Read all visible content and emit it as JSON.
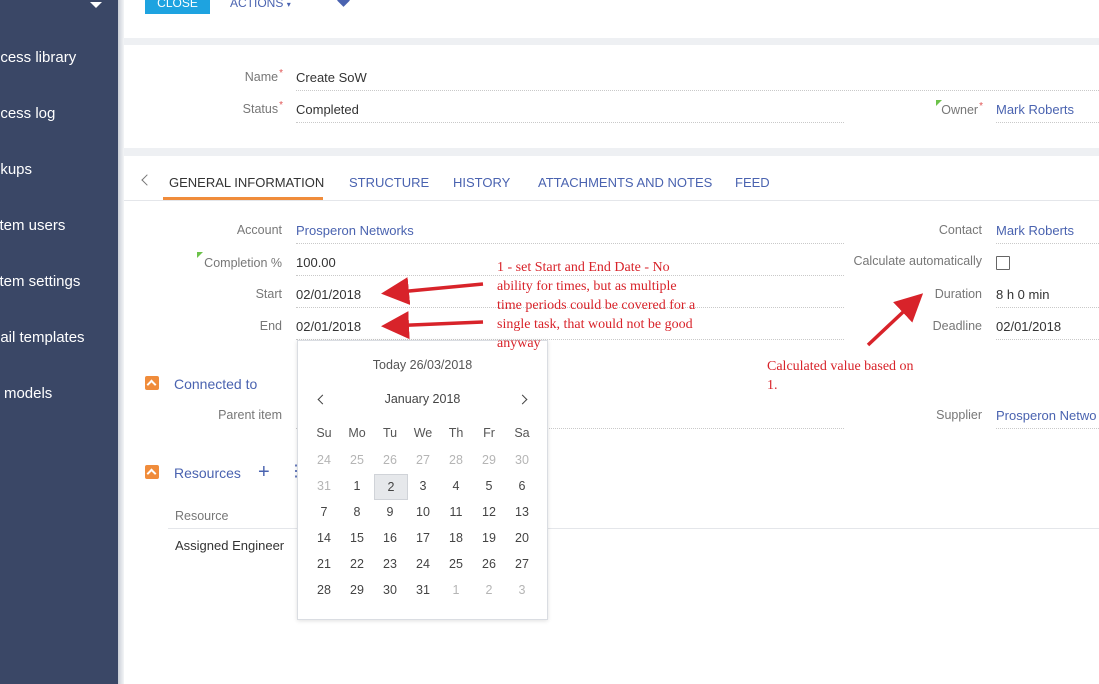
{
  "toolbar": {
    "close_label": "CLOSE",
    "actions_label": "ACTIONS"
  },
  "sidebar": {
    "items": [
      "ocess library",
      "ocess log",
      "okups",
      "stem users",
      "stem settings",
      "nail templates",
      "L models"
    ]
  },
  "header": {
    "name_label": "Name",
    "name_value": "Create SoW",
    "status_label": "Status",
    "status_value": "Completed",
    "owner_label": "Owner",
    "owner_value": "Mark Roberts"
  },
  "tabs": [
    "GENERAL INFORMATION",
    "STRUCTURE",
    "HISTORY",
    "ATTACHMENTS AND NOTES",
    "FEED"
  ],
  "general": {
    "account_label": "Account",
    "account_value": "Prosperon Networks",
    "completion_label": "Completion %",
    "completion_value": "100.00",
    "start_label": "Start",
    "start_value": "02/01/2018",
    "end_label": "End",
    "end_value": "02/01/2018",
    "contact_label": "Contact",
    "contact_value": "Mark Roberts",
    "calc_label": "Calculate automatically",
    "duration_label": "Duration",
    "duration_value": "8 h 0 min",
    "deadline_label": "Deadline",
    "deadline_value": "02/01/2018"
  },
  "connected": {
    "title": "Connected to",
    "parent_label": "Parent item",
    "supplier_label": "Supplier",
    "supplier_value": "Prosperon Netwo"
  },
  "resources": {
    "title": "Resources",
    "column_header": "Resource",
    "row_value": "Assigned Engineer"
  },
  "datepicker": {
    "today_label": "Today 26/03/2018",
    "month_label": "January 2018",
    "weekdays": [
      "Su",
      "Mo",
      "Tu",
      "We",
      "Th",
      "Fr",
      "Sa"
    ],
    "weeks": [
      [
        "24",
        "25",
        "26",
        "27",
        "28",
        "29",
        "30"
      ],
      [
        "31",
        "1",
        "2",
        "3",
        "4",
        "5",
        "6"
      ],
      [
        "7",
        "8",
        "9",
        "10",
        "11",
        "12",
        "13"
      ],
      [
        "14",
        "15",
        "16",
        "17",
        "18",
        "19",
        "20"
      ],
      [
        "21",
        "22",
        "23",
        "24",
        "25",
        "26",
        "27"
      ],
      [
        "28",
        "29",
        "30",
        "31",
        "1",
        "2",
        "3"
      ]
    ],
    "selected_day": "2"
  },
  "annotations": {
    "note1": "1 - set Start and End Date - No ability for times, but as multiple time periods could be covered for a single task, that would not be good anyway",
    "note2": "Calculated value based on 1."
  },
  "colors": {
    "sidebar": "#3a4766",
    "accent": "#4a63b0",
    "close_button": "#1ea3e0",
    "tab_active_border": "#f08c3b",
    "annotation": "#d8232a"
  }
}
